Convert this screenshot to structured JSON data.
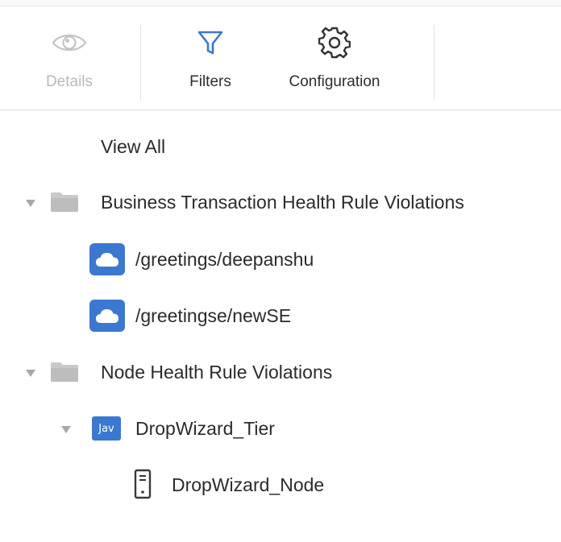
{
  "toolbar": {
    "details": {
      "label": "Details",
      "icon": "eye-icon",
      "disabled": true
    },
    "filters": {
      "label": "Filters",
      "icon": "filter-icon"
    },
    "configuration": {
      "label": "Configuration",
      "icon": "gear-icon"
    }
  },
  "tree": {
    "view_all": "View All",
    "bt_group": {
      "label": "Business Transaction Health Rule Violations",
      "icon": "folder-icon",
      "items": [
        {
          "label": "/greetings/deepanshu",
          "icon": "cloud-icon"
        },
        {
          "label": "/greetingse/newSE",
          "icon": "cloud-icon"
        }
      ]
    },
    "node_group": {
      "label": "Node Health Rule Violations",
      "icon": "folder-icon",
      "tier": {
        "label": "DropWizard_Tier",
        "badge": "Jav",
        "node": {
          "label": "DropWizard_Node",
          "icon": "server-icon"
        }
      }
    }
  },
  "colors": {
    "accent": "#3b78d0",
    "disabled": "#b9b9b9",
    "caret": "#a8a8a8"
  }
}
